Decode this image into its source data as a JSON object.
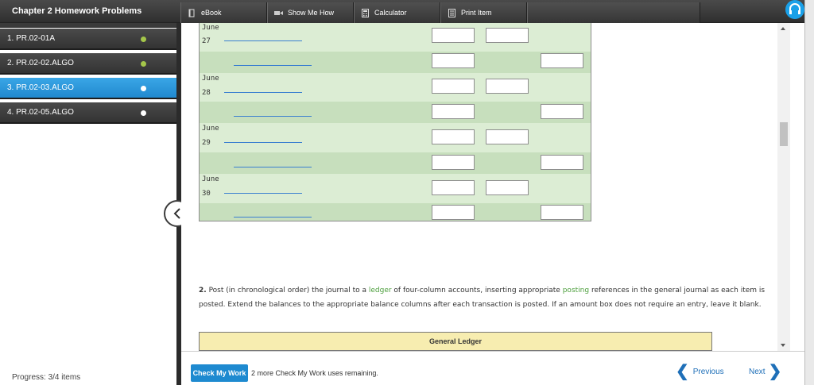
{
  "header": {
    "title": "Chapter 2 Homework Problems",
    "tools": [
      {
        "label": "eBook",
        "icon": "book-icon"
      },
      {
        "label": "Show Me How",
        "icon": "video-icon"
      },
      {
        "label": "Calculator",
        "icon": "calculator-icon"
      },
      {
        "label": "Print Item",
        "icon": "print-icon"
      }
    ],
    "help_icon": "headset-icon"
  },
  "sidebar": {
    "items": [
      {
        "label": "1. PR.02-01A",
        "status": "complete"
      },
      {
        "label": "2. PR.02-02.ALGO",
        "status": "complete"
      },
      {
        "label": "3. PR.02-03.ALGO",
        "status": "current"
      },
      {
        "label": "4. PR.02-05.ALGO",
        "status": "pending"
      }
    ],
    "progress": "Progress:  3/4 items"
  },
  "journal": {
    "entries": [
      {
        "month": "June",
        "day": "27"
      },
      {
        "month": "June",
        "day": "28"
      },
      {
        "month": "June",
        "day": "29"
      },
      {
        "month": "June",
        "day": "30"
      }
    ]
  },
  "question": {
    "number": "2.",
    "text_before": "Post (in chronological order) the journal to a ",
    "link1": "ledger",
    "text_mid": " of four-column accounts, inserting appropriate ",
    "link2": "posting",
    "text_after": " references in the general journal as each item is posted. Extend the balances to the appropriate balance columns after each transaction is posted. If an amount box does not require an entry, leave it blank."
  },
  "ledger": {
    "title": "General Ledger"
  },
  "footer": {
    "check_label": "Check My Work",
    "remaining": "2 more Check My Work uses remaining.",
    "previous": "Previous",
    "next": "Next"
  },
  "colors": {
    "accent": "#1e8ad0",
    "journal_bg": "#d5e8cc",
    "ledger_bar": "#f7edb0",
    "complete_dot": "#a4c64a"
  }
}
